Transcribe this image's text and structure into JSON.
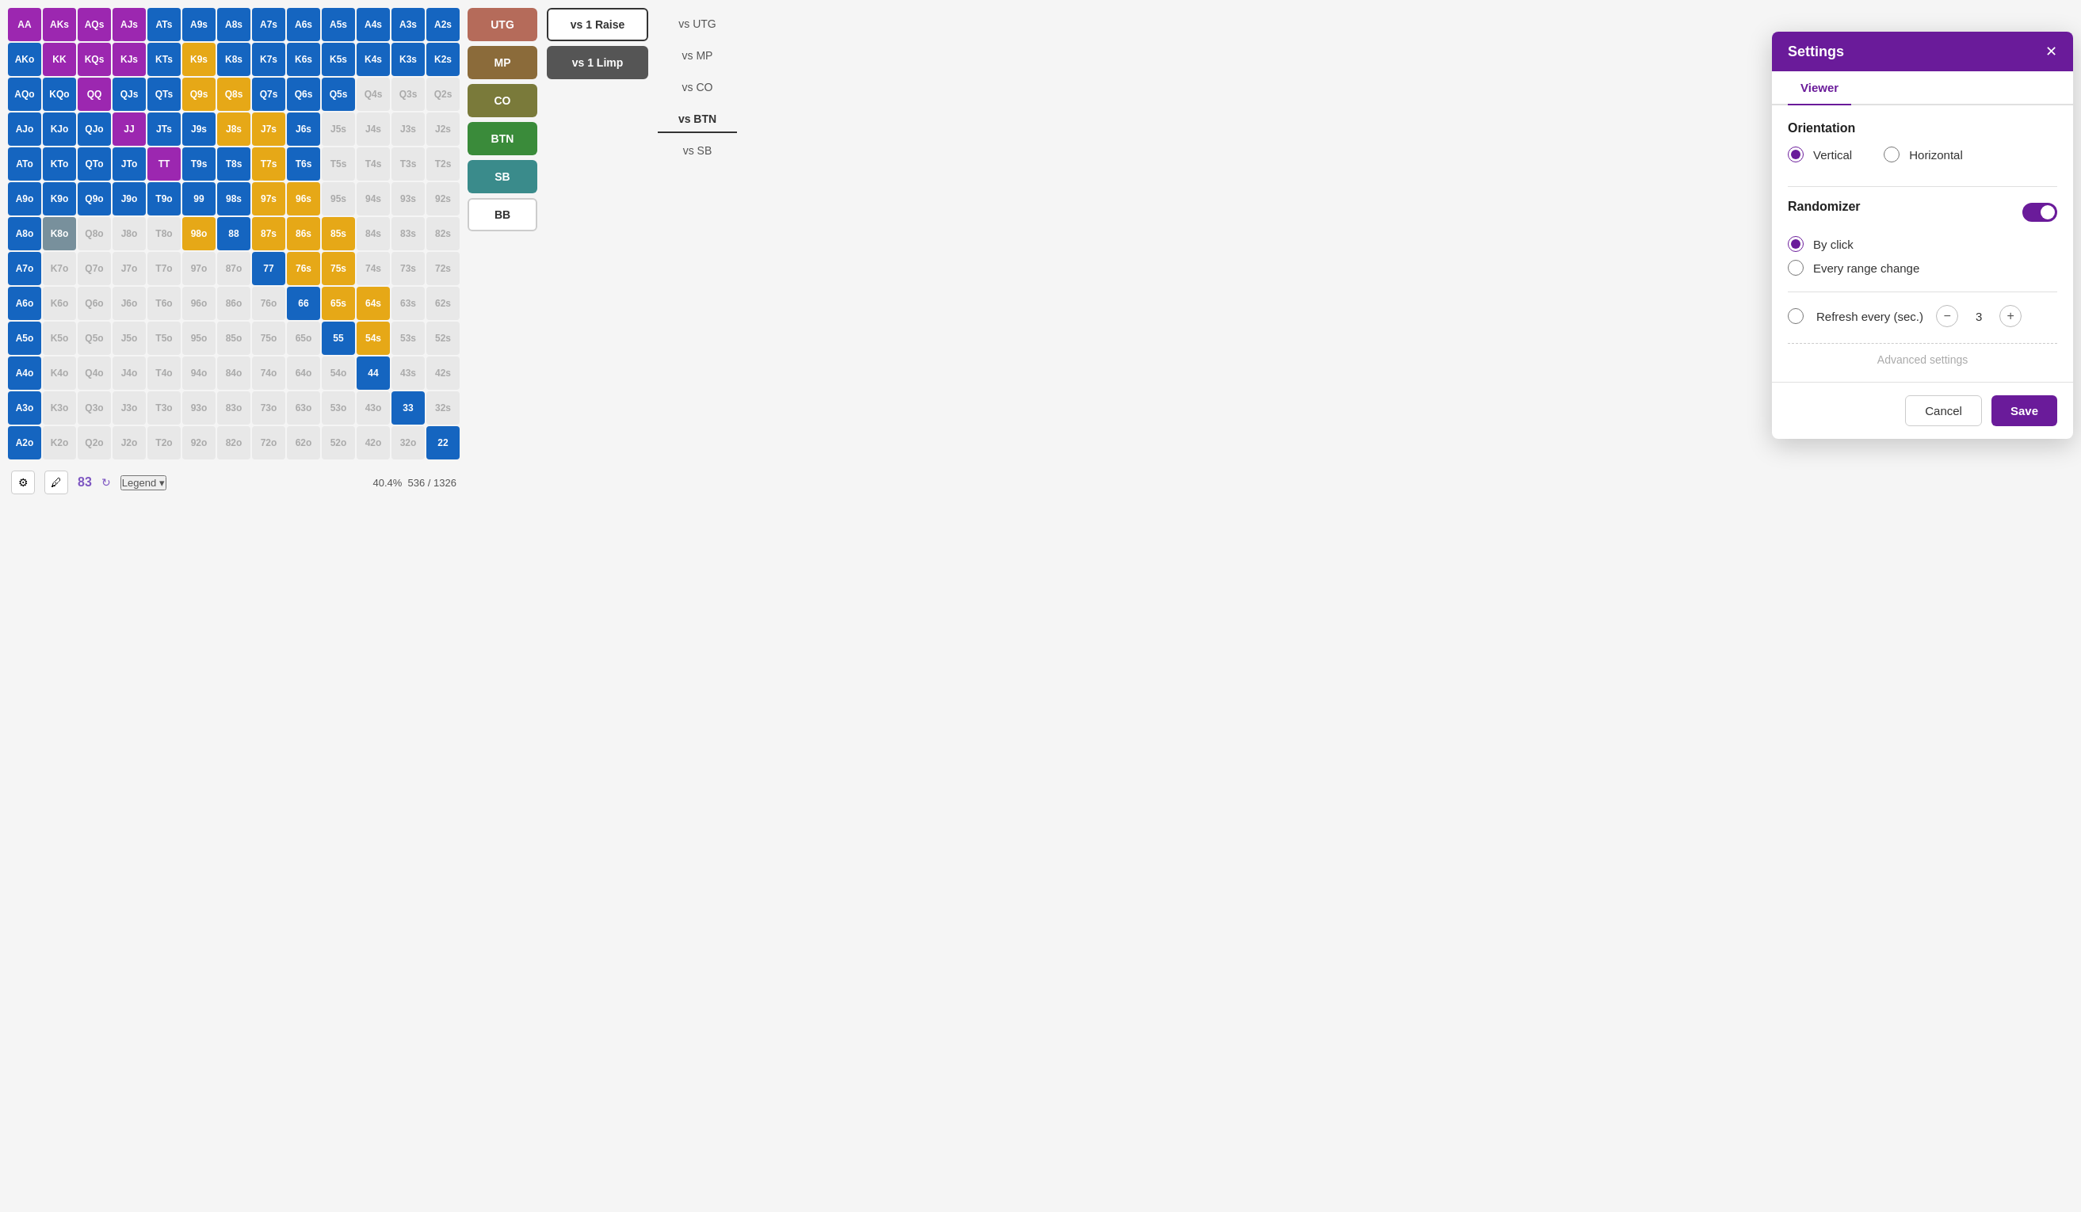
{
  "grid": {
    "rows": [
      [
        {
          "label": "AA",
          "type": "purple"
        },
        {
          "label": "AKs",
          "type": "purple"
        },
        {
          "label": "AQs",
          "type": "purple"
        },
        {
          "label": "AJs",
          "type": "purple"
        },
        {
          "label": "ATs",
          "type": "blue"
        },
        {
          "label": "A9s",
          "type": "blue"
        },
        {
          "label": "A8s",
          "type": "blue"
        },
        {
          "label": "A7s",
          "type": "blue"
        },
        {
          "label": "A6s",
          "type": "blue"
        },
        {
          "label": "A5s",
          "type": "blue"
        },
        {
          "label": "A4s",
          "type": "blue"
        },
        {
          "label": "A3s",
          "type": "blue"
        },
        {
          "label": "A2s",
          "type": "blue"
        }
      ],
      [
        {
          "label": "AKo",
          "type": "blue"
        },
        {
          "label": "KK",
          "type": "purple"
        },
        {
          "label": "KQs",
          "type": "purple"
        },
        {
          "label": "KJs",
          "type": "purple"
        },
        {
          "label": "KTs",
          "type": "blue"
        },
        {
          "label": "K9s",
          "type": "gold"
        },
        {
          "label": "K8s",
          "type": "blue"
        },
        {
          "label": "K7s",
          "type": "blue"
        },
        {
          "label": "K6s",
          "type": "blue"
        },
        {
          "label": "K5s",
          "type": "blue"
        },
        {
          "label": "K4s",
          "type": "blue"
        },
        {
          "label": "K3s",
          "type": "blue"
        },
        {
          "label": "K2s",
          "type": "blue"
        }
      ],
      [
        {
          "label": "AQo",
          "type": "blue"
        },
        {
          "label": "KQo",
          "type": "blue"
        },
        {
          "label": "QQ",
          "type": "purple"
        },
        {
          "label": "QJs",
          "type": "blue"
        },
        {
          "label": "QTs",
          "type": "blue"
        },
        {
          "label": "Q9s",
          "type": "gold"
        },
        {
          "label": "Q8s",
          "type": "gold"
        },
        {
          "label": "Q7s",
          "type": "blue"
        },
        {
          "label": "Q6s",
          "type": "blue"
        },
        {
          "label": "Q5s",
          "type": "blue"
        },
        {
          "label": "Q4s",
          "type": "empty"
        },
        {
          "label": "Q3s",
          "type": "empty"
        },
        {
          "label": "Q2s",
          "type": "empty"
        }
      ],
      [
        {
          "label": "AJo",
          "type": "blue"
        },
        {
          "label": "KJo",
          "type": "blue"
        },
        {
          "label": "QJo",
          "type": "blue"
        },
        {
          "label": "JJ",
          "type": "purple"
        },
        {
          "label": "JTs",
          "type": "blue"
        },
        {
          "label": "J9s",
          "type": "blue"
        },
        {
          "label": "J8s",
          "type": "gold"
        },
        {
          "label": "J7s",
          "type": "gold"
        },
        {
          "label": "J6s",
          "type": "blue"
        },
        {
          "label": "J5s",
          "type": "empty"
        },
        {
          "label": "J4s",
          "type": "empty"
        },
        {
          "label": "J3s",
          "type": "empty"
        },
        {
          "label": "J2s",
          "type": "empty"
        }
      ],
      [
        {
          "label": "ATo",
          "type": "blue"
        },
        {
          "label": "KTo",
          "type": "blue"
        },
        {
          "label": "QTo",
          "type": "blue"
        },
        {
          "label": "JTo",
          "type": "blue"
        },
        {
          "label": "TT",
          "type": "purple"
        },
        {
          "label": "T9s",
          "type": "blue"
        },
        {
          "label": "T8s",
          "type": "blue"
        },
        {
          "label": "T7s",
          "type": "gold"
        },
        {
          "label": "T6s",
          "type": "blue"
        },
        {
          "label": "T5s",
          "type": "empty"
        },
        {
          "label": "T4s",
          "type": "empty"
        },
        {
          "label": "T3s",
          "type": "empty"
        },
        {
          "label": "T2s",
          "type": "empty"
        }
      ],
      [
        {
          "label": "A9o",
          "type": "blue"
        },
        {
          "label": "K9o",
          "type": "blue"
        },
        {
          "label": "Q9o",
          "type": "blue"
        },
        {
          "label": "J9o",
          "type": "blue"
        },
        {
          "label": "T9o",
          "type": "blue"
        },
        {
          "label": "99",
          "type": "blue"
        },
        {
          "label": "98s",
          "type": "blue"
        },
        {
          "label": "97s",
          "type": "gold"
        },
        {
          "label": "96s",
          "type": "gold"
        },
        {
          "label": "95s",
          "type": "empty"
        },
        {
          "label": "94s",
          "type": "empty"
        },
        {
          "label": "93s",
          "type": "empty"
        },
        {
          "label": "92s",
          "type": "empty"
        }
      ],
      [
        {
          "label": "A8o",
          "type": "blue"
        },
        {
          "label": "K8o",
          "type": "gray-pair"
        },
        {
          "label": "Q8o",
          "type": "empty"
        },
        {
          "label": "J8o",
          "type": "empty"
        },
        {
          "label": "T8o",
          "type": "empty"
        },
        {
          "label": "98o",
          "type": "gold"
        },
        {
          "label": "88",
          "type": "blue"
        },
        {
          "label": "87s",
          "type": "gold"
        },
        {
          "label": "86s",
          "type": "gold"
        },
        {
          "label": "85s",
          "type": "gold"
        },
        {
          "label": "84s",
          "type": "empty"
        },
        {
          "label": "83s",
          "type": "empty"
        },
        {
          "label": "82s",
          "type": "empty"
        }
      ],
      [
        {
          "label": "A7o",
          "type": "blue"
        },
        {
          "label": "K7o",
          "type": "empty"
        },
        {
          "label": "Q7o",
          "type": "empty"
        },
        {
          "label": "J7o",
          "type": "empty"
        },
        {
          "label": "T7o",
          "type": "empty"
        },
        {
          "label": "97o",
          "type": "empty"
        },
        {
          "label": "87o",
          "type": "empty"
        },
        {
          "label": "77",
          "type": "blue"
        },
        {
          "label": "76s",
          "type": "gold"
        },
        {
          "label": "75s",
          "type": "gold"
        },
        {
          "label": "74s",
          "type": "empty"
        },
        {
          "label": "73s",
          "type": "empty"
        },
        {
          "label": "72s",
          "type": "empty"
        }
      ],
      [
        {
          "label": "A6o",
          "type": "blue"
        },
        {
          "label": "K6o",
          "type": "empty"
        },
        {
          "label": "Q6o",
          "type": "empty"
        },
        {
          "label": "J6o",
          "type": "empty"
        },
        {
          "label": "T6o",
          "type": "empty"
        },
        {
          "label": "96o",
          "type": "empty"
        },
        {
          "label": "86o",
          "type": "empty"
        },
        {
          "label": "76o",
          "type": "empty"
        },
        {
          "label": "66",
          "type": "blue"
        },
        {
          "label": "65s",
          "type": "gold"
        },
        {
          "label": "64s",
          "type": "gold"
        },
        {
          "label": "63s",
          "type": "empty"
        },
        {
          "label": "62s",
          "type": "empty"
        }
      ],
      [
        {
          "label": "A5o",
          "type": "blue"
        },
        {
          "label": "K5o",
          "type": "empty"
        },
        {
          "label": "Q5o",
          "type": "empty"
        },
        {
          "label": "J5o",
          "type": "empty"
        },
        {
          "label": "T5o",
          "type": "empty"
        },
        {
          "label": "95o",
          "type": "empty"
        },
        {
          "label": "85o",
          "type": "empty"
        },
        {
          "label": "75o",
          "type": "empty"
        },
        {
          "label": "65o",
          "type": "empty"
        },
        {
          "label": "55",
          "type": "blue"
        },
        {
          "label": "54s",
          "type": "gold"
        },
        {
          "label": "53s",
          "type": "empty"
        },
        {
          "label": "52s",
          "type": "empty"
        }
      ],
      [
        {
          "label": "A4o",
          "type": "blue"
        },
        {
          "label": "K4o",
          "type": "empty"
        },
        {
          "label": "Q4o",
          "type": "empty"
        },
        {
          "label": "J4o",
          "type": "empty"
        },
        {
          "label": "T4o",
          "type": "empty"
        },
        {
          "label": "94o",
          "type": "empty"
        },
        {
          "label": "84o",
          "type": "empty"
        },
        {
          "label": "74o",
          "type": "empty"
        },
        {
          "label": "64o",
          "type": "empty"
        },
        {
          "label": "54o",
          "type": "empty"
        },
        {
          "label": "44",
          "type": "blue"
        },
        {
          "label": "43s",
          "type": "empty"
        },
        {
          "label": "42s",
          "type": "empty"
        }
      ],
      [
        {
          "label": "A3o",
          "type": "blue"
        },
        {
          "label": "K3o",
          "type": "empty"
        },
        {
          "label": "Q3o",
          "type": "empty"
        },
        {
          "label": "J3o",
          "type": "empty"
        },
        {
          "label": "T3o",
          "type": "empty"
        },
        {
          "label": "93o",
          "type": "empty"
        },
        {
          "label": "83o",
          "type": "empty"
        },
        {
          "label": "73o",
          "type": "empty"
        },
        {
          "label": "63o",
          "type": "empty"
        },
        {
          "label": "53o",
          "type": "empty"
        },
        {
          "label": "43o",
          "type": "empty"
        },
        {
          "label": "33",
          "type": "blue"
        },
        {
          "label": "32s",
          "type": "empty"
        }
      ],
      [
        {
          "label": "A2o",
          "type": "blue"
        },
        {
          "label": "K2o",
          "type": "empty"
        },
        {
          "label": "Q2o",
          "type": "empty"
        },
        {
          "label": "J2o",
          "type": "empty"
        },
        {
          "label": "T2o",
          "type": "empty"
        },
        {
          "label": "92o",
          "type": "empty"
        },
        {
          "label": "82o",
          "type": "empty"
        },
        {
          "label": "72o",
          "type": "empty"
        },
        {
          "label": "62o",
          "type": "empty"
        },
        {
          "label": "52o",
          "type": "empty"
        },
        {
          "label": "42o",
          "type": "empty"
        },
        {
          "label": "32o",
          "type": "empty"
        },
        {
          "label": "22",
          "type": "blue"
        }
      ]
    ]
  },
  "positions": [
    {
      "label": "UTG",
      "color": "#b56b5a"
    },
    {
      "label": "MP",
      "color": "#8b6b3a"
    },
    {
      "label": "CO",
      "color": "#7a7a3a"
    },
    {
      "label": "BTN",
      "color": "#3a8b3a"
    },
    {
      "label": "SB",
      "color": "#3a8b8b"
    },
    {
      "label": "BB",
      "color": "white",
      "textColor": "#333",
      "border": true
    }
  ],
  "actions": [
    {
      "label": "vs 1 Raise",
      "style": "outline"
    },
    {
      "label": "vs 1 Limp",
      "style": "dark"
    }
  ],
  "vs_nav": [
    {
      "label": "vs UTG",
      "active": false
    },
    {
      "label": "vs MP",
      "active": false
    },
    {
      "label": "vs CO",
      "active": false
    },
    {
      "label": "vs BTN",
      "active": true
    },
    {
      "label": "vs SB",
      "active": false
    }
  ],
  "bottom_bar": {
    "combo_count": "83",
    "legend_label": "Legend",
    "percent": "40.4%",
    "combos": "536 / 1326"
  },
  "settings": {
    "title": "Settings",
    "close_label": "✕",
    "tabs": [
      "Viewer"
    ],
    "active_tab": "Viewer",
    "orientation_section": "Orientation",
    "orientation_vertical": "Vertical",
    "orientation_horizontal": "Horizontal",
    "selected_orientation": "vertical",
    "randomizer_section": "Randomizer",
    "randomizer_enabled": true,
    "randomizer_by_click": "By click",
    "randomizer_every_range": "Every range change",
    "selected_randomizer": "by_click",
    "refresh_section": "Refresh every (sec.)",
    "refresh_value": "3",
    "advanced_settings": "Advanced settings",
    "cancel_label": "Cancel",
    "save_label": "Save"
  }
}
